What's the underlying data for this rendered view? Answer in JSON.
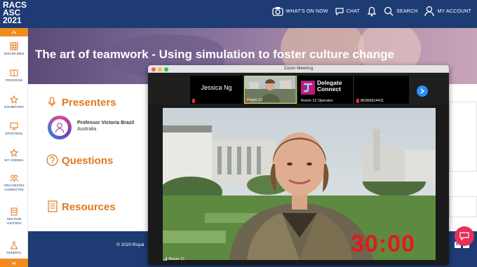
{
  "app": {
    "logo_line1": "RACS",
    "logo_line2": "ASC",
    "logo_line3": "2021"
  },
  "topnav": {
    "items": [
      {
        "label": "WHAT'S ON NOW",
        "icon": "camera-icon"
      },
      {
        "label": "CHAT",
        "icon": "chat-icon"
      },
      {
        "label": "",
        "icon": "bell-icon"
      },
      {
        "label": "SEARCH",
        "icon": "search-icon"
      },
      {
        "label": "MY ACCOUNT",
        "icon": "user-icon"
      }
    ]
  },
  "sidebar": {
    "items": [
      {
        "label": "DISCIPLINES",
        "icon": "grid-icon"
      },
      {
        "label": "PROGRAM",
        "icon": "book-icon"
      },
      {
        "label": "EXHIBITORS",
        "icon": "star-icon"
      },
      {
        "label": "EPOSTERS",
        "icon": "monitor-icon"
      },
      {
        "label": "MY AGENDA",
        "icon": "star-icon"
      },
      {
        "label": "ORGANISING",
        "label2": "COMMITTEE",
        "icon": "people-icon"
      },
      {
        "label": "SECTION",
        "label2": "VISITORS",
        "icon": "building-icon"
      },
      {
        "label": "GENERAL",
        "icon": "flask-icon"
      }
    ]
  },
  "page": {
    "title": "The art of teamwork - Using simulation to foster culture change",
    "presenters_heading": "Presenters",
    "presenter_name": "Professor Victoria Brazil",
    "presenter_country": "Australia",
    "questions_heading": "Questions",
    "resources_heading": "Resources",
    "footer_text": "© 2020 Royal"
  },
  "zoom": {
    "window_title": "Zoom Meeting",
    "participants": [
      {
        "name": "Jessica Ng",
        "label": ""
      },
      {
        "name": "",
        "label": "Room 12"
      },
      {
        "name": "Delegate Connect",
        "label": "Room 12 Operator"
      },
      {
        "name": "",
        "label": "86366914411"
      }
    ],
    "main_video_label": "Room 12",
    "timer": "30:00"
  },
  "colors": {
    "navy": "#1f3b73",
    "orange": "#e07a1f",
    "timer_red": "#e01b1b",
    "zoom_blue": "#2d8cff"
  }
}
